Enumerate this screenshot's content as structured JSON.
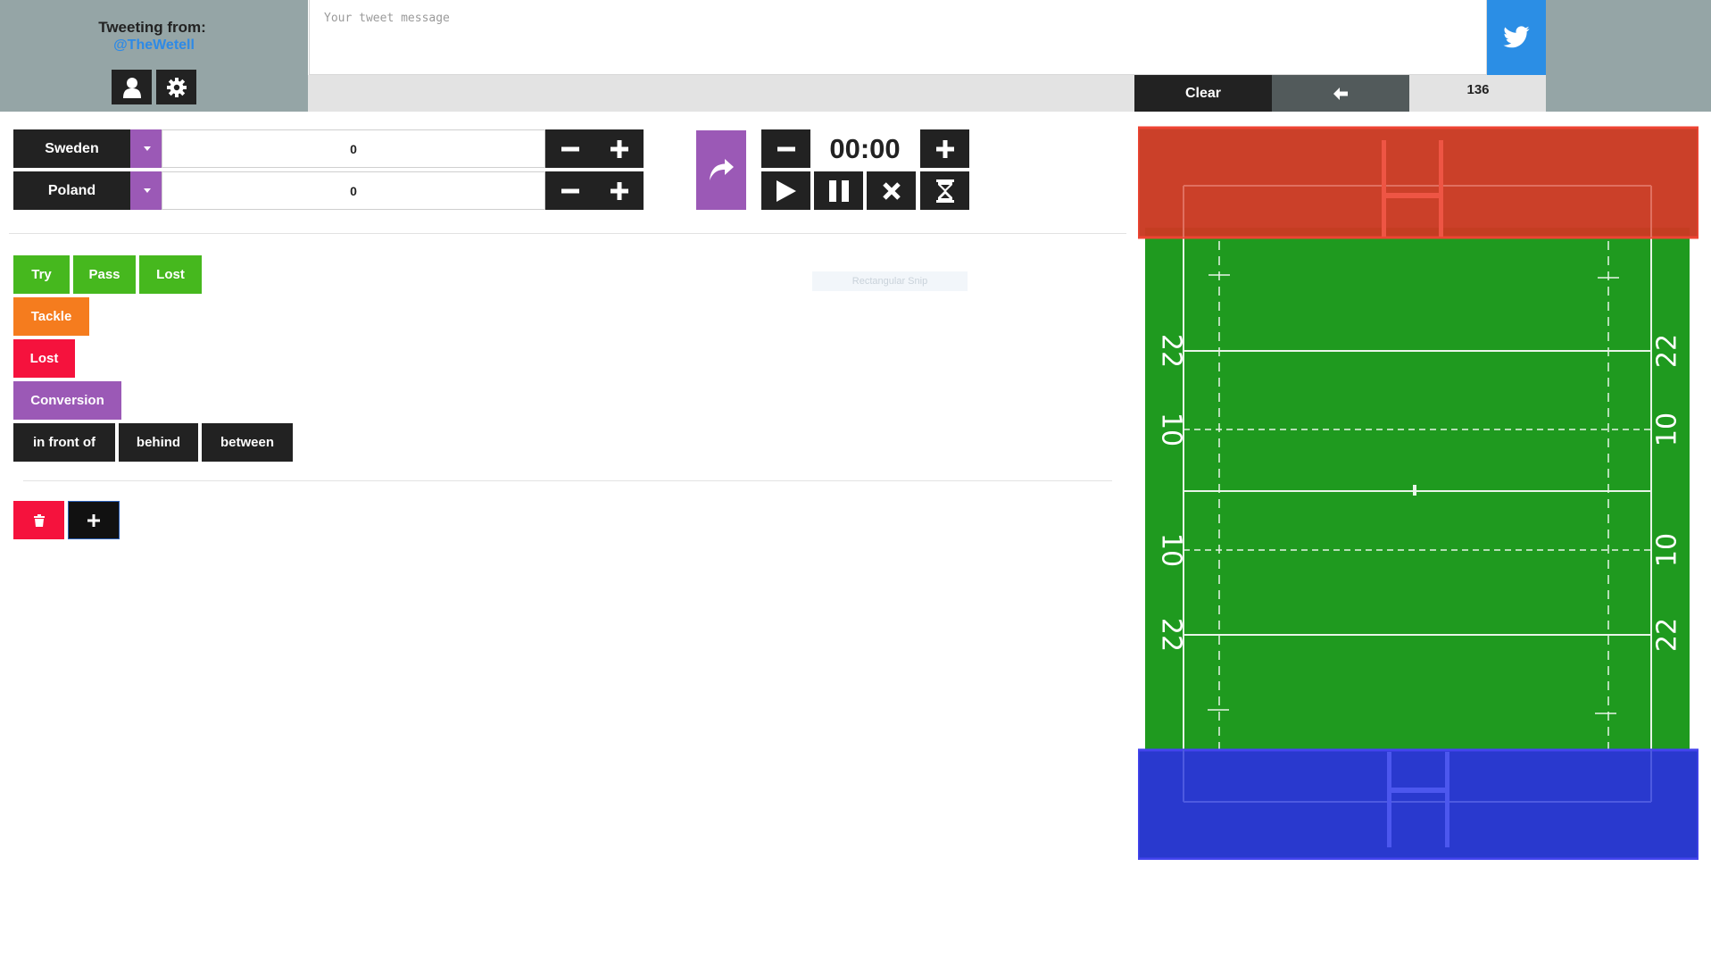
{
  "header": {
    "tweeting_from_label": "Tweeting from:",
    "handle": "@TheWetell",
    "tweet_placeholder": "Your tweet message",
    "tweet_value": "",
    "clear_label": "Clear",
    "char_count": "136"
  },
  "teams": [
    {
      "name": "Sweden",
      "score": "0"
    },
    {
      "name": "Poland",
      "score": "0"
    }
  ],
  "clock": {
    "time": "00:00"
  },
  "actions": {
    "try": "Try",
    "pass": "Pass",
    "lost_green": "Lost",
    "tackle": "Tackle",
    "lost_red": "Lost",
    "conversion": "Conversion",
    "in_front_of": "in front of",
    "behind": "behind",
    "between": "between"
  },
  "tooltip": "Rectangular Snip",
  "pitch": {
    "line_labels": [
      "22",
      "10",
      "10",
      "22"
    ]
  },
  "colors": {
    "header_gray": "#95a5a6",
    "twitter_blue": "#2b8ee5",
    "dark": "#222222",
    "purple": "#9b59b6",
    "green": "#46b81e",
    "orange": "#f57c1e",
    "red": "#f5123d",
    "pitch_green": "#1f9a1f",
    "top_zone": "#c93a22",
    "bottom_zone": "#2233cc"
  },
  "icons": [
    "user-icon",
    "gear-icon",
    "twitter-bird-icon",
    "arrow-left-icon",
    "chevron-down-icon",
    "minus-icon",
    "plus-icon",
    "redo-icon",
    "play-icon",
    "pause-icon",
    "close-icon",
    "hourglass-icon",
    "trash-icon"
  ]
}
